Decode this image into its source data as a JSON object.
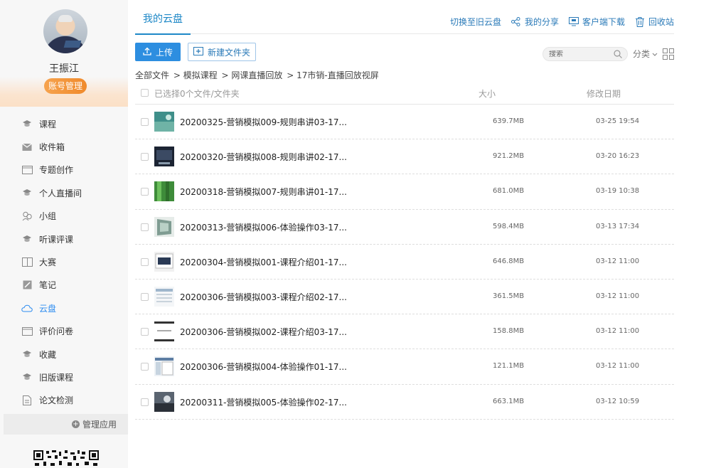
{
  "sidebar": {
    "user_name": "王振江",
    "account_button": "账号管理",
    "items": [
      {
        "label": "课程",
        "icon": "graduation-cap-icon"
      },
      {
        "label": "收件箱",
        "icon": "mail-icon"
      },
      {
        "label": "专题创作",
        "icon": "window-icon"
      },
      {
        "label": "个人直播间",
        "icon": "graduation-cap-icon"
      },
      {
        "label": "小组",
        "icon": "group-icon"
      },
      {
        "label": "听课评课",
        "icon": "graduation-cap-icon"
      },
      {
        "label": "大赛",
        "icon": "book-icon"
      },
      {
        "label": "笔记",
        "icon": "note-icon"
      },
      {
        "label": "云盘",
        "icon": "cloud-icon",
        "active": true
      },
      {
        "label": "评价问卷",
        "icon": "window-icon"
      },
      {
        "label": "收藏",
        "icon": "graduation-cap-icon"
      },
      {
        "label": "旧版课程",
        "icon": "graduation-cap-icon"
      },
      {
        "label": "论文检测",
        "icon": "document-icon"
      }
    ],
    "manage_apps": "管理应用"
  },
  "header": {
    "tab": "我的云盘",
    "links": {
      "switch_old": "切换至旧云盘",
      "my_share": "我的分享",
      "client_download": "客户端下载",
      "recycle_bin": "回收站"
    }
  },
  "toolbar": {
    "upload": "上传",
    "new_folder": "新建文件夹",
    "search_placeholder": "搜索",
    "sort": "分类"
  },
  "breadcrumb": [
    "全部文件",
    " > 模拟课程",
    " > 网课直播回放",
    " > 17市销-直播回放视屏"
  ],
  "table": {
    "selected_text": "已选择0个文件/文件夹",
    "col_size": "大小",
    "col_date": "修改日期",
    "rows": [
      {
        "name": "20200325-营销模拟009-规则串讲03-17...",
        "size": "639.7MB",
        "date": "03-25 19:54"
      },
      {
        "name": "20200320-营销模拟008-规则串讲02-17...",
        "size": "921.2MB",
        "date": "03-20 16:23"
      },
      {
        "name": "20200318-营销模拟007-规则串讲01-17...",
        "size": "681.0MB",
        "date": "03-19 10:38"
      },
      {
        "name": "20200313-营销模拟006-体验操作03-17...",
        "size": "598.4MB",
        "date": "03-13 17:34"
      },
      {
        "name": "20200304-营销模拟001-课程介绍01-17...",
        "size": "646.8MB",
        "date": "03-12 11:00"
      },
      {
        "name": "20200306-营销模拟003-课程介绍02-17...",
        "size": "361.5MB",
        "date": "03-12 11:00"
      },
      {
        "name": "20200306-营销模拟002-课程介绍03-17...",
        "size": "158.8MB",
        "date": "03-12 11:00"
      },
      {
        "name": "20200306-营销模拟004-体验操作01-17...",
        "size": "121.1MB",
        "date": "03-12 11:00"
      },
      {
        "name": "20200311-营销模拟005-体验操作02-17...",
        "size": "663.1MB",
        "date": "03-12 10:59"
      }
    ]
  },
  "colors": {
    "accent": "#1e88c7",
    "upload_button": "#2d8ee0",
    "account_button": "#f08a2c",
    "active_menu": "#2d8cf0"
  }
}
